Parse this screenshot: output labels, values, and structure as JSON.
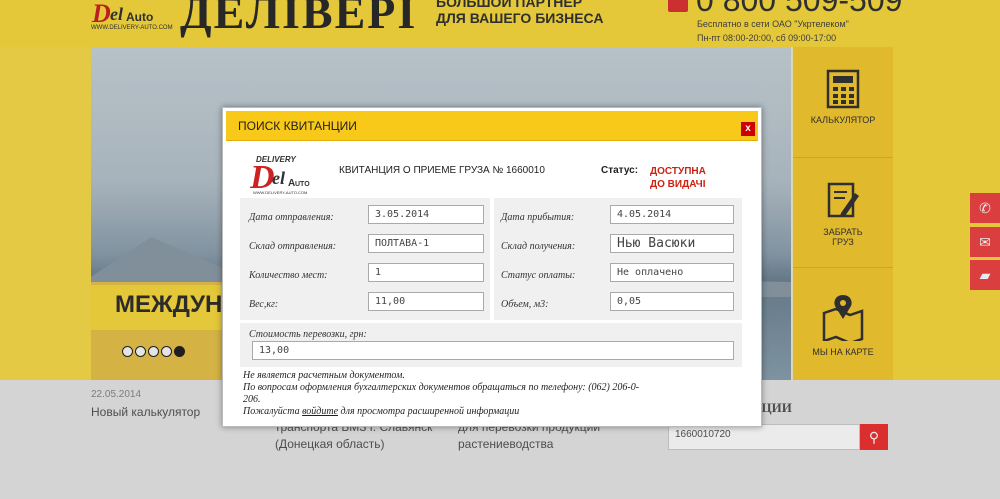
{
  "header": {
    "logo_url": "WWW.DELIVERY-AUTO.COM",
    "brand": "ДЕЛIВЕРI",
    "slogan_line1": "БОЛЬШОЙ ПАРТНЕР",
    "slogan_line2": "ДЛЯ ВАШЕГО БИЗНЕСА",
    "phone": "0 800 509-509",
    "phone_note": "Бесплатно в сети ОАО \"Укртелеком\"",
    "hours": "Пн-пт 08:00-20:00, сб 09:00-17:00"
  },
  "hero": {
    "banner_text": "МЕЖДУН",
    "slides": 5,
    "active_slide": 5
  },
  "right_menu": [
    {
      "icon": "calculator-icon",
      "label": "КАЛЬКУЛЯТОР"
    },
    {
      "icon": "edit-icon",
      "label_line1": "ЗАБРАТЬ",
      "label_line2": "ГРУЗ"
    },
    {
      "icon": "map-icon",
      "label": "МЫ НА КАРТЕ"
    }
  ],
  "float_buttons": [
    "phone-icon",
    "mail-icon",
    "chat-icon"
  ],
  "news": {
    "date": "22.05.2014",
    "title": "Новый калькулятор",
    "item2_line1": "транспорта БМЗ г. Славянск",
    "item2_line2": "(Донецкая область)",
    "item3_line1": "для перевозки продукции",
    "item3_line2": "растениеводства"
  },
  "search": {
    "heading": "АНЦИИ",
    "value": "1660010720"
  },
  "modal": {
    "title": "ПОИСК КВИТАНЦИИ",
    "close": "x",
    "logo_url": "WWW.DELIVERY-AUTO.COM",
    "receipt": "КВИТАНЦИЯ О ПРИЕМЕ ГРУЗА № 1660010",
    "status_label": "Статус:",
    "status_line1": "ДОСТУПНА",
    "status_line2": "ДО ВИДАЧІ",
    "fields": {
      "send_date_label": "Дата отправления:",
      "send_date": "3.05.2014",
      "arrive_date_label": "Дата прибытия:",
      "arrive_date": "4.05.2014",
      "from_label": "Склад отправления:",
      "from": "ПОЛТАВА-1",
      "to_label": "Склад получения:",
      "to": "Нью Васюки",
      "places_label": "Количество мест:",
      "places": "1",
      "pay_label": "Статус оплаты:",
      "pay": "Не оплачено",
      "weight_label": "Вес,кг:",
      "weight": "11,00",
      "volume_label": "Объем, м3:",
      "volume": "0,05",
      "cost_label": "Стоимость перевозки, грн:",
      "cost": "13,00"
    },
    "note1": "Не является расчетным документом.",
    "note2": "По вопросам оформления бухгалтерских документов обращаться по телефону: (062) 206-0-",
    "note2b": "206.",
    "note3_pre": "Пожалуйста ",
    "note3_link": "войдите",
    "note3_post": " для просмотра расширенной информации"
  }
}
